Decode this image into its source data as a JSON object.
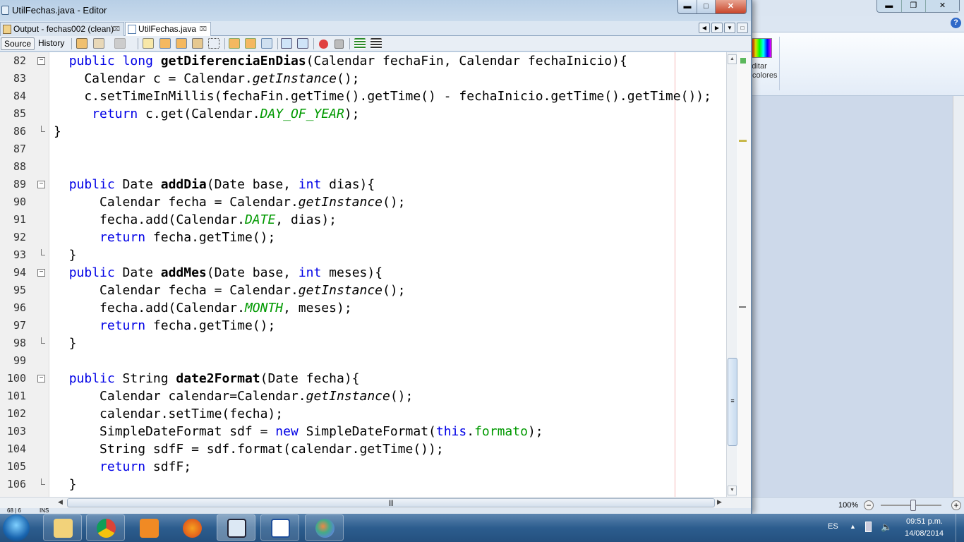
{
  "window": {
    "title": "UtilFechas.java - Editor"
  },
  "tabs": [
    {
      "label": "Output - fechas002 (clean)",
      "active": false
    },
    {
      "label": "UtilFechas.java",
      "active": true
    }
  ],
  "toolbar": {
    "source_label": "Source",
    "history_label": "History"
  },
  "editor": {
    "lines": [
      {
        "n": "82",
        "fold": "open",
        "tokens": [
          [
            "  ",
            ""
          ],
          [
            "public",
            "kw"
          ],
          [
            " ",
            ""
          ],
          [
            "long",
            "kw"
          ],
          [
            " ",
            ""
          ],
          [
            "getDiferenciaEnDias",
            "md"
          ],
          [
            "(Calendar fechaFin, Calendar fechaInicio){",
            ""
          ]
        ]
      },
      {
        "n": "83",
        "tokens": [
          [
            "    Calendar c = Calendar.",
            ""
          ],
          [
            "getInstance",
            "sm"
          ],
          [
            "();",
            ""
          ]
        ]
      },
      {
        "n": "84",
        "tokens": [
          [
            "    c.setTimeInMillis(fechaFin.getTime().getTime() - fechaInicio.getTime().getTime());",
            ""
          ]
        ]
      },
      {
        "n": "85",
        "tokens": [
          [
            "     ",
            ""
          ],
          [
            "return",
            "kw"
          ],
          [
            " c.get(Calendar.",
            ""
          ],
          [
            "DAY_OF_YEAR",
            "sf"
          ],
          [
            ");",
            ""
          ]
        ]
      },
      {
        "n": "86",
        "fold": "end",
        "tokens": [
          [
            "}",
            ""
          ]
        ]
      },
      {
        "n": "87",
        "tokens": []
      },
      {
        "n": "88",
        "tokens": []
      },
      {
        "n": "89",
        "fold": "open",
        "tokens": [
          [
            "  ",
            ""
          ],
          [
            "public",
            "kw"
          ],
          [
            " Date ",
            ""
          ],
          [
            "addDia",
            "md"
          ],
          [
            "(Date base, ",
            ""
          ],
          [
            "int",
            "kw"
          ],
          [
            " dias){",
            ""
          ]
        ]
      },
      {
        "n": "90",
        "tokens": [
          [
            "      Calendar fecha = Calendar.",
            ""
          ],
          [
            "getInstance",
            "sm"
          ],
          [
            "();",
            ""
          ]
        ]
      },
      {
        "n": "91",
        "tokens": [
          [
            "      fecha.add(Calendar.",
            ""
          ],
          [
            "DATE",
            "sf"
          ],
          [
            ", dias);",
            ""
          ]
        ]
      },
      {
        "n": "92",
        "tokens": [
          [
            "      ",
            ""
          ],
          [
            "return",
            "kw"
          ],
          [
            " fecha.getTime();",
            ""
          ]
        ]
      },
      {
        "n": "93",
        "fold": "end",
        "tokens": [
          [
            "  }",
            ""
          ]
        ]
      },
      {
        "n": "94",
        "fold": "open",
        "tokens": [
          [
            "  ",
            ""
          ],
          [
            "public",
            "kw"
          ],
          [
            " Date ",
            ""
          ],
          [
            "addMes",
            "md"
          ],
          [
            "(Date base, ",
            ""
          ],
          [
            "int",
            "kw"
          ],
          [
            " meses){",
            ""
          ]
        ]
      },
      {
        "n": "95",
        "tokens": [
          [
            "      Calendar fecha = Calendar.",
            ""
          ],
          [
            "getInstance",
            "sm"
          ],
          [
            "();",
            ""
          ]
        ]
      },
      {
        "n": "96",
        "tokens": [
          [
            "      fecha.add(Calendar.",
            ""
          ],
          [
            "MONTH",
            "sf"
          ],
          [
            ", meses);",
            ""
          ]
        ]
      },
      {
        "n": "97",
        "tokens": [
          [
            "      ",
            ""
          ],
          [
            "return",
            "kw"
          ],
          [
            " fecha.getTime();",
            ""
          ]
        ]
      },
      {
        "n": "98",
        "fold": "end",
        "tokens": [
          [
            "  }",
            ""
          ]
        ]
      },
      {
        "n": "99",
        "tokens": []
      },
      {
        "n": "100",
        "fold": "open",
        "tokens": [
          [
            "  ",
            ""
          ],
          [
            "public",
            "kw"
          ],
          [
            " String ",
            ""
          ],
          [
            "date2Format",
            "md"
          ],
          [
            "(Date fecha){",
            ""
          ]
        ]
      },
      {
        "n": "101",
        "tokens": [
          [
            "      Calendar calendar=Calendar.",
            ""
          ],
          [
            "getInstance",
            "sm"
          ],
          [
            "();",
            ""
          ]
        ]
      },
      {
        "n": "102",
        "tokens": [
          [
            "      calendar.setTime(fecha);",
            ""
          ]
        ]
      },
      {
        "n": "103",
        "tokens": [
          [
            "      SimpleDateFormat sdf = ",
            ""
          ],
          [
            "new",
            "kw"
          ],
          [
            " SimpleDateFormat(",
            ""
          ],
          [
            "this",
            "kw"
          ],
          [
            ".",
            ""
          ],
          [
            "formato",
            "fd"
          ],
          [
            ");",
            ""
          ]
        ]
      },
      {
        "n": "104",
        "tokens": [
          [
            "      String sdfF = sdf.format(calendar.getTime());",
            ""
          ]
        ]
      },
      {
        "n": "105",
        "tokens": [
          [
            "      ",
            ""
          ],
          [
            "return",
            "kw"
          ],
          [
            " sdfF;",
            ""
          ]
        ]
      },
      {
        "n": "106",
        "fold": "end",
        "tokens": [
          [
            "  }",
            ""
          ]
        ]
      }
    ]
  },
  "statusbar": {
    "position": "68 | 6",
    "mode": "INS"
  },
  "paint": {
    "edit_colors_label": "Editar colores",
    "zoom": "100%"
  },
  "taskbar": {
    "apps": [
      "windows-explorer",
      "chrome",
      "media-player",
      "firefox",
      "netbeans",
      "word",
      "paint"
    ],
    "tray": {
      "language": "ES",
      "time": "09:51 p.m.",
      "date": "14/08/2014"
    }
  }
}
